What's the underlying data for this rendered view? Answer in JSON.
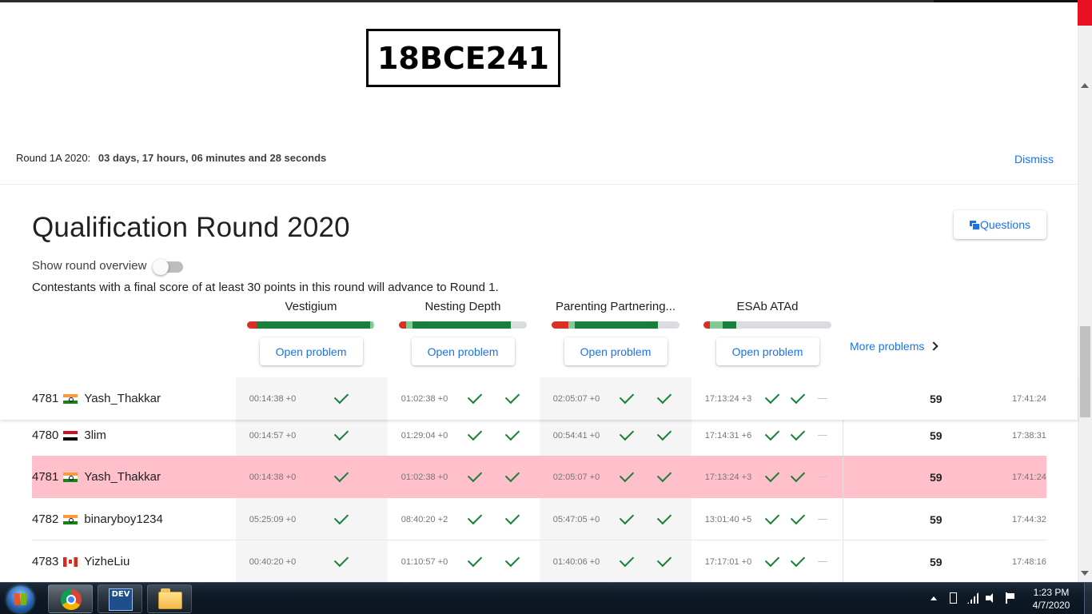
{
  "watermark": "18BCE241",
  "banner": {
    "label": "Round 1A 2020:",
    "time": "03 days, 17 hours, 06 minutes and 28 seconds",
    "dismiss_label": "Dismiss"
  },
  "round": {
    "title": "Qualification Round 2020",
    "questions_label": "Questions",
    "overview_label": "Show round overview",
    "overview_enabled": false,
    "advance_text": "Contestants with a final score of at least 30 points in this round will advance to Round 1."
  },
  "problems": [
    {
      "name": "Vestigium",
      "open_label": "Open problem"
    },
    {
      "name": "Nesting Depth",
      "open_label": "Open problem"
    },
    {
      "name": "Parenting Partnering...",
      "open_label": "Open problem"
    },
    {
      "name": "ESAb ATAd",
      "open_label": "Open problem"
    }
  ],
  "more_problems_label": "More problems",
  "colors": {
    "accent": "#1a73e8",
    "success": "#188038",
    "highlight_row": "#ffc0cb",
    "bar_red": "#d93025",
    "bar_green": "#188038",
    "bar_light_green": "#81c995",
    "bar_empty": "#dadce0"
  },
  "sticky_row": {
    "rank": "4781",
    "flag": "india-flag-icon",
    "name": "Yash_Thakkar",
    "times": [
      "00:14:38 +0",
      "01:02:38 +0",
      "02:05:07 +0",
      "17:13:24 +3"
    ],
    "score": "59",
    "penalty": "17:41:24"
  },
  "rows": [
    {
      "rank": "4780",
      "flag": "egypt-flag-icon",
      "name": "3lim",
      "times": [
        "00:14:57 +0",
        "01:29:04 +0",
        "00:54:41 +0",
        "17:14:31 +6"
      ],
      "score": "59",
      "penalty": "17:38:31"
    },
    {
      "rank": "4781",
      "flag": "india-flag-icon",
      "name": "Yash_Thakkar",
      "times": [
        "00:14:38 +0",
        "01:02:38 +0",
        "02:05:07 +0",
        "17:13:24 +3"
      ],
      "score": "59",
      "penalty": "17:41:24"
    },
    {
      "rank": "4782",
      "flag": "india-flag-icon",
      "name": "binaryboy1234",
      "times": [
        "05:25:09 +0",
        "08:40:20 +2",
        "05:47:05 +0",
        "13:01:40 +5"
      ],
      "score": "59",
      "penalty": "17:44:32"
    },
    {
      "rank": "4783",
      "flag": "canada-flag-icon",
      "name": "YizheLiu",
      "times": [
        "00:40:20 +0",
        "01:10:57 +0",
        "01:40:06 +0",
        "17:17:01 +0"
      ],
      "score": "59",
      "penalty": "17:48:16"
    }
  ],
  "taskbar": {
    "apps": [
      "chrome-icon",
      "dev-cpp-icon",
      "file-explorer-icon"
    ],
    "dev_label": "DEV",
    "time": "1:23 PM",
    "date": "4/7/2020"
  }
}
